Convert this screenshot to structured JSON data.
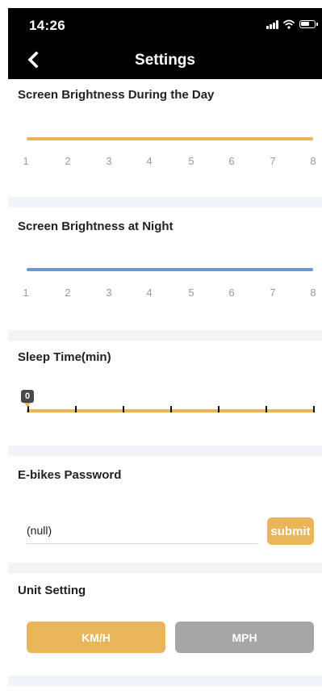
{
  "status_bar": {
    "time": "14:26"
  },
  "nav": {
    "title": "Settings"
  },
  "colors": {
    "accent": "#e9b55a",
    "night_track": "#6a96d3",
    "inactive": "#a6a6a6",
    "section_gap": "#f1f4f7"
  },
  "day_brightness": {
    "title": "Screen Brightness During the Day",
    "ticks": [
      "1",
      "2",
      "3",
      "4",
      "5",
      "6",
      "7",
      "8"
    ]
  },
  "night_brightness": {
    "title": "Screen Brightness at Night",
    "ticks": [
      "1",
      "2",
      "3",
      "4",
      "5",
      "6",
      "7",
      "8"
    ]
  },
  "sleep_time": {
    "title": "Sleep Time(min)",
    "value": "0",
    "tick_count": 7
  },
  "password": {
    "title": "E-bikes Password",
    "value": "(null)",
    "submit_label": "submit"
  },
  "units": {
    "title": "Unit Setting",
    "km_label": "KM/H",
    "mph_label": "MPH",
    "selected": "KM/H"
  }
}
